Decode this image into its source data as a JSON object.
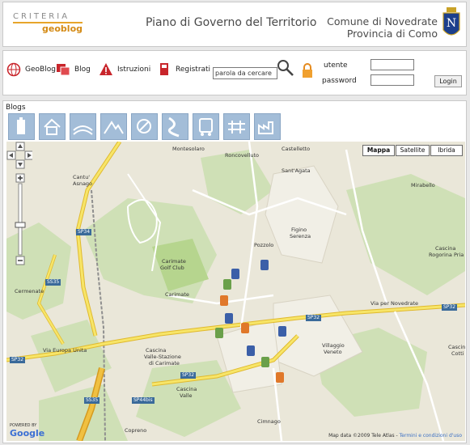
{
  "header": {
    "logo_top": "CRITERIA",
    "logo_sub": "geoblog",
    "title": "Piano di Governo del Territorio",
    "comune_line1": "Comune di Novedrate",
    "comune_line2": "Provincia di Como",
    "crest_letter": "N"
  },
  "toolbar": {
    "geoblog": "GeoBlog",
    "blog": "Blog",
    "istruzioni": "Istruzioni",
    "registrati": "Registrati",
    "search_value": "parola da cercare",
    "utente_label": "utente",
    "password_label": "password",
    "login_label": "Login"
  },
  "blogs": {
    "title": "Blogs",
    "categories": [
      "building-icon",
      "house-icon",
      "agriculture-icon",
      "landscape-icon",
      "hand-icon",
      "river-icon",
      "transport-icon",
      "infrastructure-icon",
      "industry-icon"
    ]
  },
  "map": {
    "type_buttons": [
      "Mappa",
      "Satellite",
      "Ibrida"
    ],
    "places": {
      "cantu": "Cantu'",
      "asnago": "Asnago",
      "montesolaro": "Montesolaro",
      "roncovelluto": "Roncovelluto",
      "castelletto": "Castelletto",
      "santagata": "Sant'Agata",
      "mirabello": "Mirabello",
      "figino": "Figino",
      "serenza": "Serenza",
      "pozzolo": "Pozzolo",
      "carimate_golf": "Carimate",
      "golf_club": "Golf Club",
      "carimate": "Carimate",
      "cermenate": "Cermenate",
      "cascina_rogorina": "Cascina",
      "rogorina": "Rogorina Pria",
      "cascina2": "Cascina",
      "valle_stazione": "Valle-Stazione",
      "di_carimate": "di Carimate",
      "villaggio": "Villaggio",
      "veneto": "Veneto",
      "cascina_valle": "Cascina",
      "valle": "Valle",
      "copreno": "Copreno",
      "cimnago": "Cimnago",
      "cascina_cotti": "Cascina",
      "cotti": "Cotti"
    },
    "roads": {
      "via_per_novedrate": "Via per Novedrate",
      "via_europa_unita": "Via Europa Unita",
      "sp32": "SP32",
      "sp32b": "SP32",
      "sp32c": "SP32",
      "sp32d": "SP32",
      "ss35": "SS35",
      "ss35b": "SS35",
      "sp44bis": "SP44bis",
      "sp34": "SP34"
    },
    "copyright_prefix": "Map data ©2009 Tele Atlas - ",
    "copyright_link": "Termini e condizioni d'uso",
    "powered_small": "POWERED BY",
    "powered_google": "Google"
  }
}
